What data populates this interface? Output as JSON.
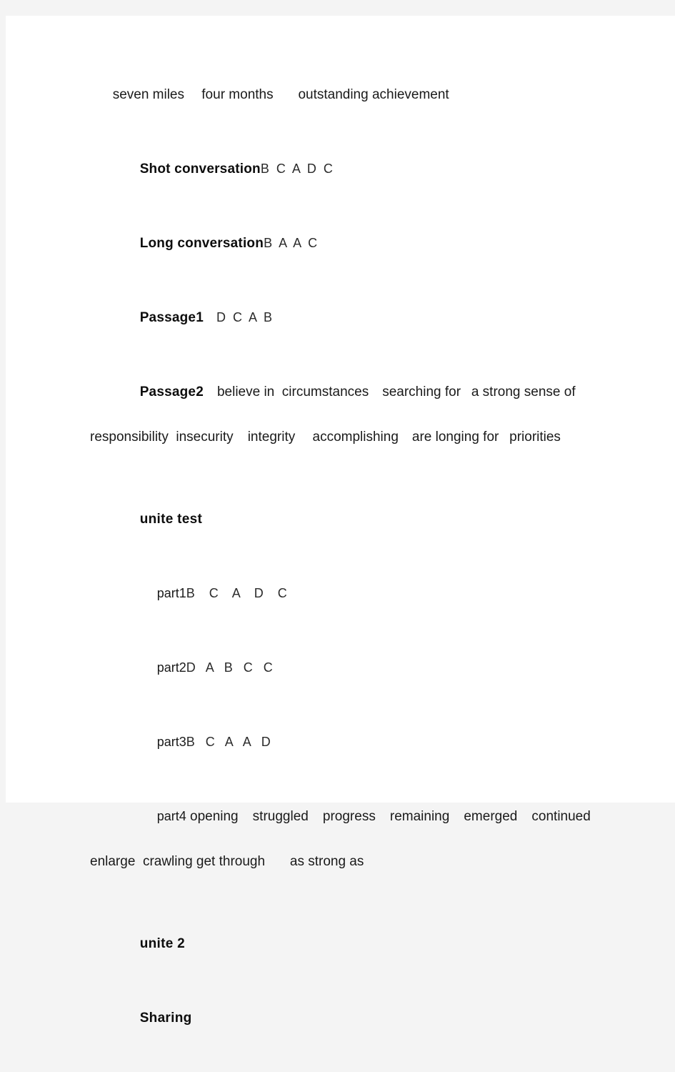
{
  "page": {
    "background_color": "#f4f4f4",
    "paper_color": "#ffffff",
    "text_color": "#1a1a1a"
  },
  "content": {
    "phrase_line": "seven miles  four months    outstanding achievement",
    "short_conversation": {
      "label": "Shot conversation",
      "answers": "B  C  A  D  C"
    },
    "long_conversation": {
      "label": "Long conversation",
      "answers": "B  A  A  C"
    },
    "passage1": {
      "label": "Passage1",
      "answers": " D  C  A  B"
    },
    "passage2": {
      "label": "Passage2",
      "line1": " believe in  circumstances searching for  a strong sense of",
      "line2": "responsibility  insecurity   integrity  accomplishing are longing for  priorities"
    },
    "unit_test_heading": "unite test",
    "part1": {
      "label": "part1",
      "answers": "B    C    A    D    C"
    },
    "part2": {
      "label": "part2",
      "answers": "D   A   B   C   C"
    },
    "part3": {
      "label": "part3",
      "answers": "B   C   A   A   D"
    },
    "part4": {
      "label": "part4",
      "line1": " opening   struggled   progress   remaining   emerged   continued",
      "line2": "enlarge  crawling get through    as strong as"
    },
    "unit2_heading": "unite 2",
    "sharing_heading": "Sharing"
  }
}
